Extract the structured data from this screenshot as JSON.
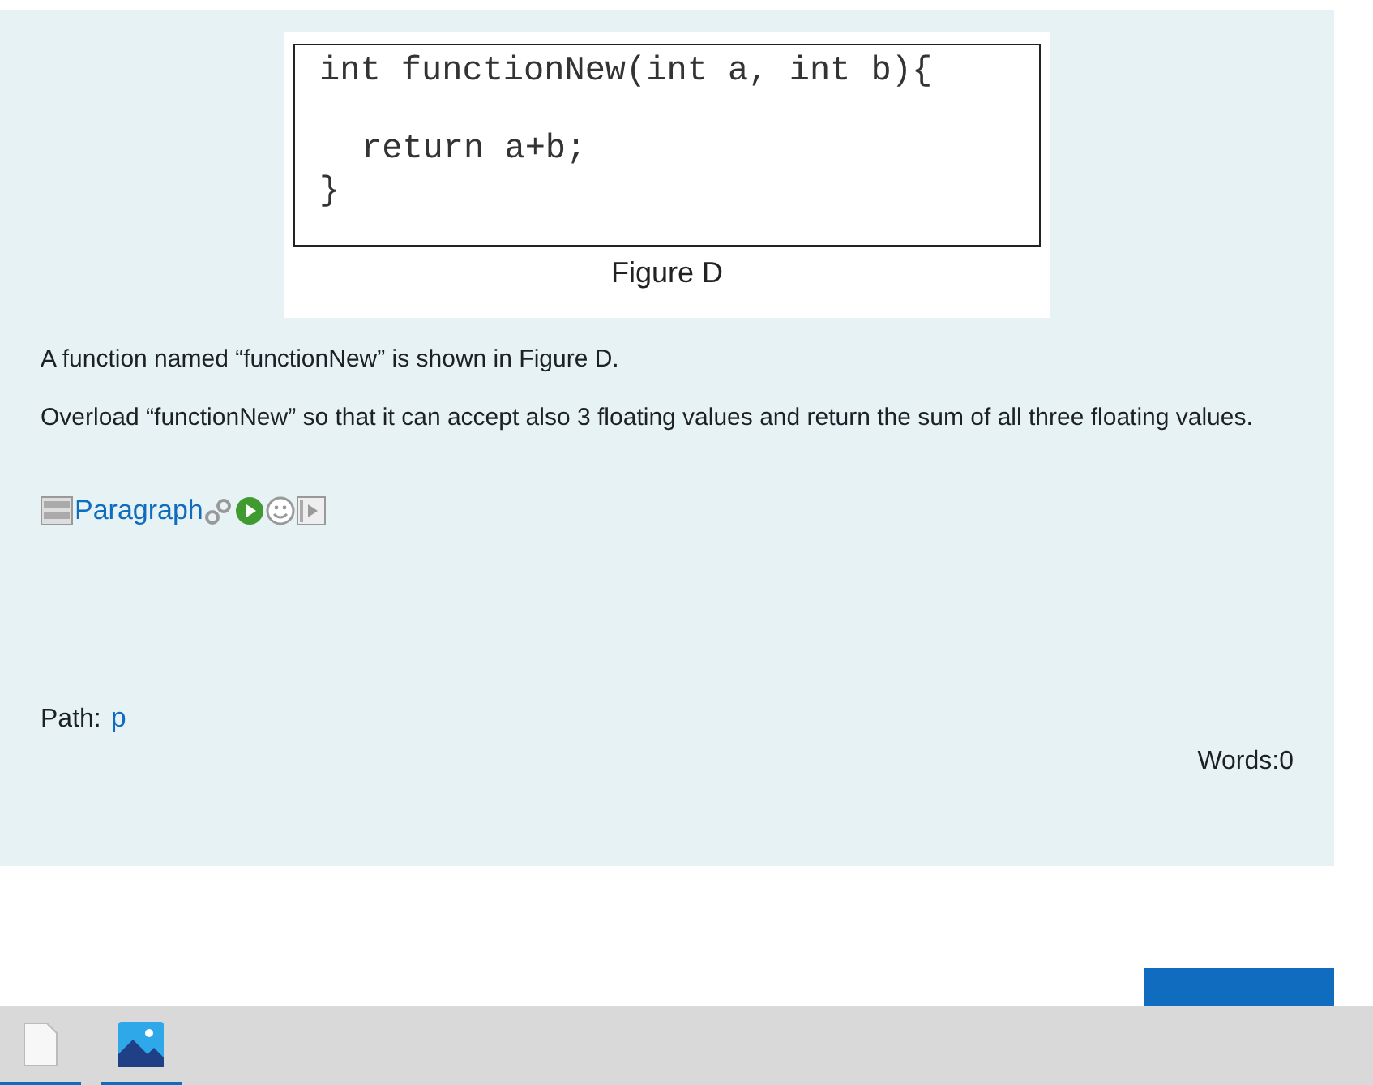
{
  "figure": {
    "code_lines": [
      {
        "text": "int functionNew(int a, int b){",
        "kind": "head"
      },
      {
        "text": "return a+b;",
        "kind": "body"
      },
      {
        "text": "}",
        "kind": "end"
      }
    ],
    "caption": "Figure D"
  },
  "question": [
    "A function named “functionNew” is shown in Figure D.",
    "Overload “functionNew” so that it can accept also 3 floating values and return the sum of all three floating values."
  ],
  "editor": {
    "format_label": "Paragraph",
    "path_label": "Path:",
    "path_value": "p",
    "word_count": "Words:0"
  },
  "taskbar": [
    {
      "kind": "document"
    },
    {
      "kind": "photos"
    }
  ]
}
